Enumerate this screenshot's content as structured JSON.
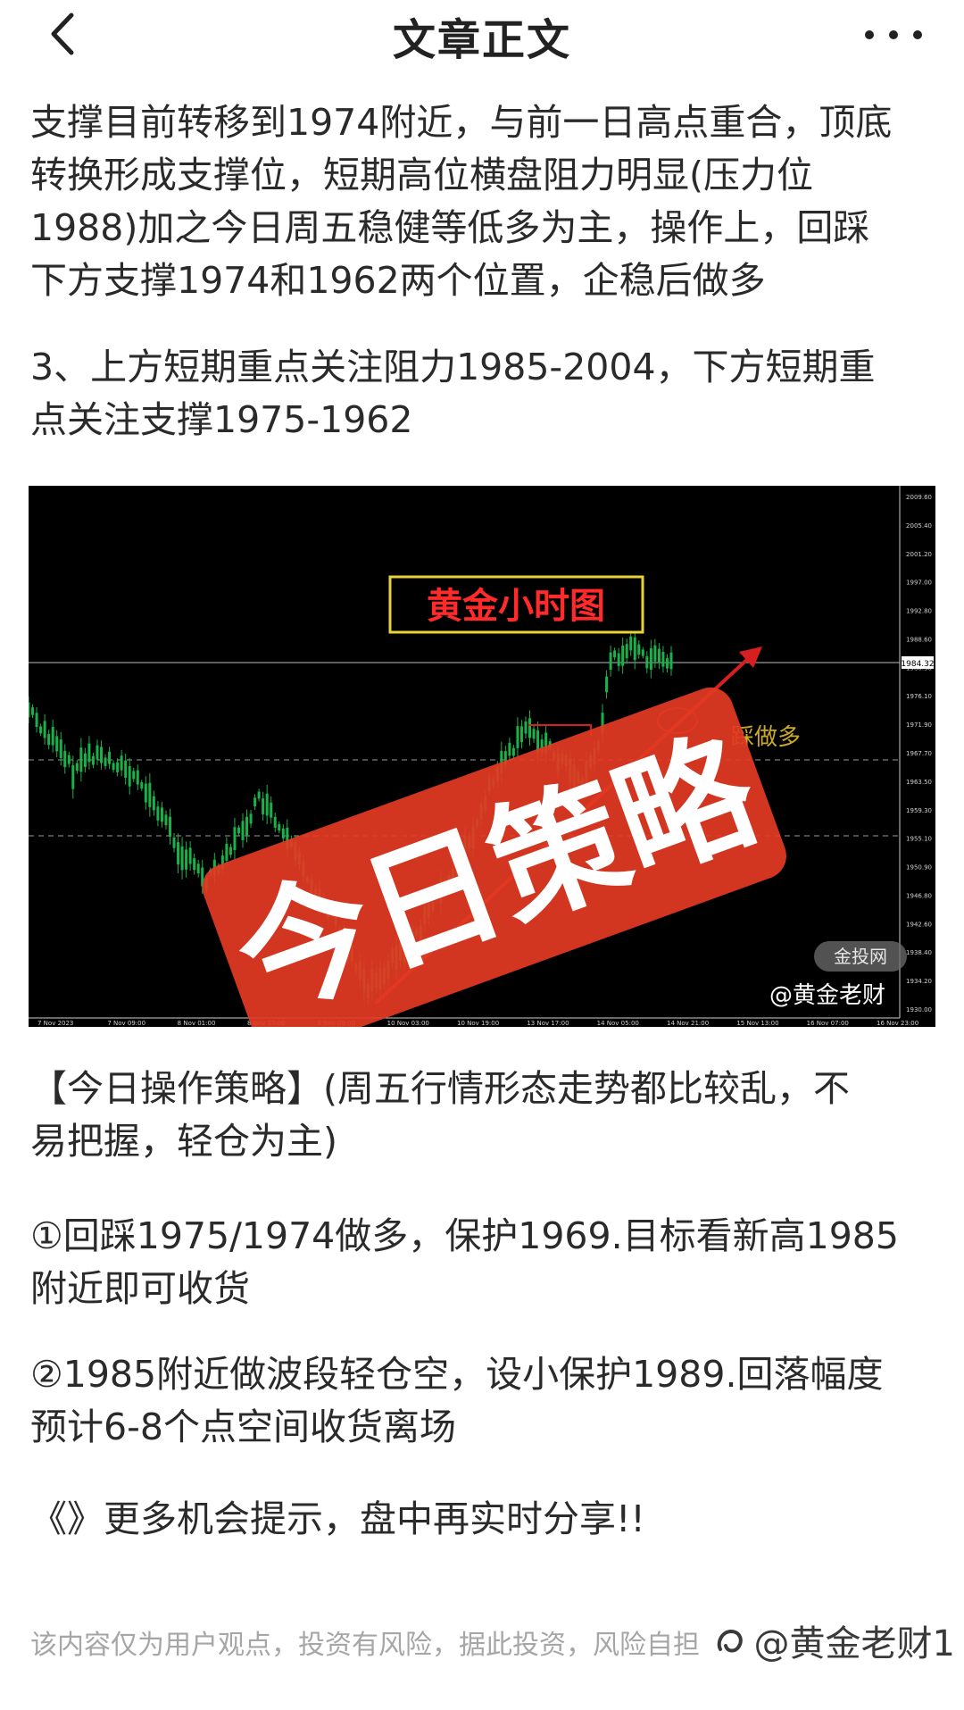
{
  "header": {
    "title": "文章正文",
    "back_icon": "chevron-left-icon",
    "more_icon": "more-dots-icon"
  },
  "article": {
    "p1": [
      "支撑目前转移到1974附近，与前一日高点重合，顶底",
      "转换形成支撑位，短期高位横盘阻力明显(压力位",
      "1988)加之今日周五稳健等低多为主，操作上，回踩",
      "下方支撑1974和1962两个位置，企稳后做多"
    ],
    "p2": [
      "3、上方短期重点关注阻力1985-2004，下方短期重",
      "点关注支撑1975-1962"
    ],
    "p3": [
      "【今日操作策略】(周五行情形态走势都比较乱，不",
      "易把握，轻仓为主)"
    ],
    "p4": [
      "①回踩1975/1974做多，保护1969.目标看新高1985",
      "附近即可收货"
    ],
    "p5": [
      "②1985附近做波段轻仓空，设小保护1989.回落幅度",
      "预计6-8个点空间收货离场"
    ],
    "p6": [
      "《》更多机会提示，盘中再实时分享!!"
    ]
  },
  "chart_image": {
    "chart_title": "黄金小时图",
    "stamp_text": "今日策略",
    "annotation": "踩做多",
    "site_badge": "金投网",
    "watermark": "@黄金老财",
    "current_price": "1984.32",
    "price_ticks": [
      "2009.60",
      "2005.40",
      "2001.20",
      "1997.00",
      "1992.80",
      "1988.60",
      "1980.30",
      "1976.10",
      "1971.90",
      "1967.70",
      "1963.50",
      "1959.30",
      "1955.10",
      "1950.90",
      "1946.80",
      "1942.60",
      "1938.40",
      "1934.20",
      "1930.00"
    ],
    "time_ticks": [
      "7 Nov 2023",
      "7 Nov 09:00",
      "8 Nov 01:00",
      "8 Nov 17:00",
      "9 Nov 09:00",
      "10 Nov 03:00",
      "10 Nov 19:00",
      "13 Nov 17:00",
      "14 Nov 05:00",
      "14 Nov 21:00",
      "15 Nov 13:00",
      "16 Nov 07:00",
      "16 Nov 23:00"
    ],
    "colors": {
      "candle": "#19b24a",
      "stamp": "#e23a22",
      "title_red": "#ff2a2a",
      "title_border": "#e8d23a",
      "annotation": "#c9a927"
    }
  },
  "footer": {
    "disclaimer": "该内容仅为用户观点，投资有风险，据此投资，风险自担",
    "watermark": "@黄金老财1"
  }
}
